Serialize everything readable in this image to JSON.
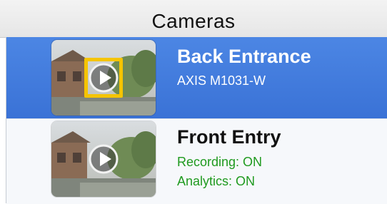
{
  "header": {
    "title": "Cameras"
  },
  "cameras": [
    {
      "name": "Back Entrance",
      "model": "AXIS M1031-W",
      "selected": true,
      "thumbnail_icon": "play-icon"
    },
    {
      "name": "Front Entry",
      "recording": "Recording: ON",
      "analytics": "Analytics: ON",
      "selected": false,
      "thumbnail_icon": "play-icon"
    }
  ],
  "colors": {
    "selection": "#3a72d6",
    "status_green": "#1f9a1f",
    "highlight": "#f5c400"
  }
}
